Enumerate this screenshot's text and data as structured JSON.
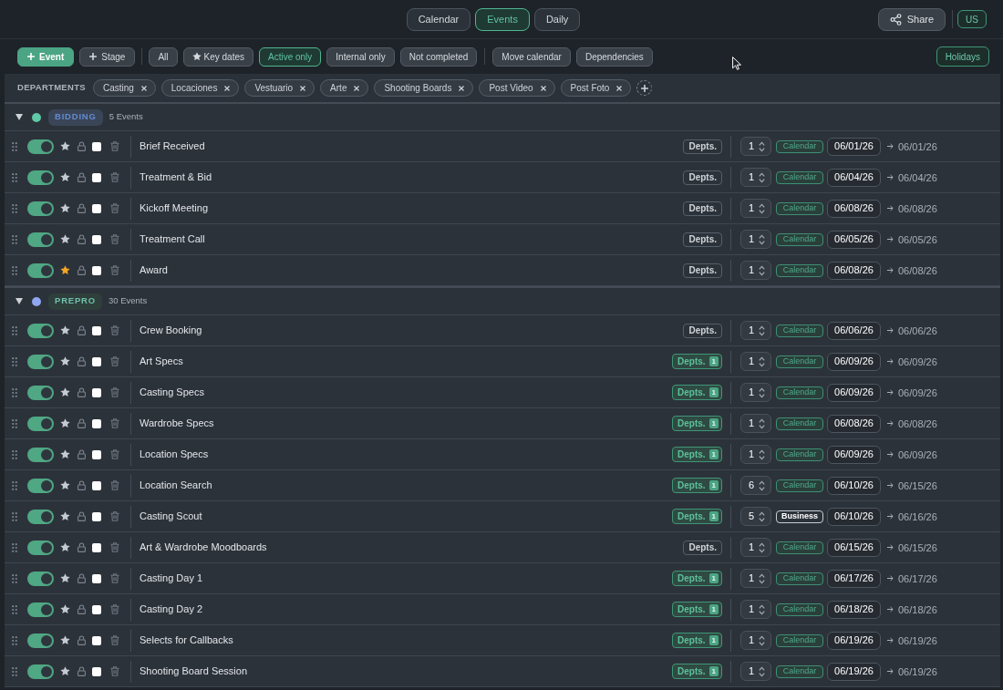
{
  "view_tabs": [
    {
      "label": "Calendar",
      "selected": false
    },
    {
      "label": "Events",
      "selected": true
    },
    {
      "label": "Daily",
      "selected": false
    }
  ],
  "share_button": "Share",
  "region_button": "US",
  "toolbar": {
    "create_buttons": [
      {
        "label": "Event",
        "kind": "primary"
      },
      {
        "label": "Stage",
        "kind": "secondary"
      }
    ],
    "filters": [
      {
        "label": "All",
        "kind": "plain",
        "selected": false
      },
      {
        "label": "Key dates",
        "kind": "key",
        "selected": false
      },
      {
        "label": "Active only",
        "kind": "plain",
        "selected": true
      },
      {
        "label": "Internal only",
        "kind": "plain",
        "selected": false
      },
      {
        "label": "Not completed",
        "kind": "plain",
        "selected": false
      }
    ],
    "actions": [
      "Move calendar",
      "Dependencies"
    ],
    "holidays": {
      "label": "Holidays",
      "on": true
    }
  },
  "departments": {
    "label": "DEPARTMENTS",
    "chips": [
      "Casting",
      "Locaciones",
      "Vestuario",
      "Arte",
      "Shooting Boards",
      "Post Video",
      "Post Foto"
    ]
  },
  "groups": [
    {
      "badge": {
        "label": "BIDDING",
        "color": "#3a4557"
      },
      "count": "5 Events",
      "expanded": true,
      "color": "#5fcaa5",
      "events": [
        {
          "name": "Brief Received",
          "enabled": true,
          "starred": false,
          "checked": false,
          "depts": {
            "label": "Depts."
          },
          "duration": "1",
          "day_type": {
            "kind": "calendar",
            "label": "Calendar"
          },
          "start": "06/01/26",
          "end": "06/01/26"
        },
        {
          "name": "Treatment & Bid",
          "enabled": true,
          "starred": false,
          "checked": false,
          "depts": {
            "label": "Depts."
          },
          "duration": "1",
          "day_type": {
            "kind": "calendar",
            "label": "Calendar"
          },
          "start": "06/04/26",
          "end": "06/04/26"
        },
        {
          "name": "Kickoff Meeting",
          "enabled": true,
          "starred": false,
          "checked": false,
          "depts": {
            "label": "Depts."
          },
          "duration": "1",
          "day_type": {
            "kind": "calendar",
            "label": "Calendar"
          },
          "start": "06/08/26",
          "end": "06/08/26"
        },
        {
          "name": "Treatment Call",
          "enabled": true,
          "starred": false,
          "checked": false,
          "depts": {
            "label": "Depts."
          },
          "duration": "1",
          "day_type": {
            "kind": "calendar",
            "label": "Calendar"
          },
          "start": "06/05/26",
          "end": "06/05/26"
        },
        {
          "name": "Award",
          "enabled": true,
          "starred": true,
          "checked": false,
          "depts": {
            "label": "Depts."
          },
          "duration": "1",
          "day_type": {
            "kind": "calendar",
            "label": "Calendar"
          },
          "start": "06/08/26",
          "end": "06/08/26"
        }
      ]
    },
    {
      "badge": {
        "label": "PREPRO",
        "color": "#2f3f3b"
      },
      "count": "30 Events",
      "expanded": true,
      "color": "#8fa7ef",
      "events": [
        {
          "name": "Crew Booking",
          "enabled": true,
          "starred": false,
          "checked": false,
          "depts": {
            "label": "Depts."
          },
          "duration": "1",
          "day_type": {
            "kind": "calendar",
            "label": "Calendar"
          },
          "start": "06/06/26",
          "end": "06/06/26"
        },
        {
          "name": "Art Specs",
          "enabled": true,
          "starred": false,
          "checked": false,
          "depts": {
            "label": "Depts.",
            "count": "1"
          },
          "duration": "1",
          "day_type": {
            "kind": "calendar",
            "label": "Calendar"
          },
          "start": "06/09/26",
          "end": "06/09/26"
        },
        {
          "name": "Casting Specs",
          "enabled": true,
          "starred": false,
          "checked": false,
          "depts": {
            "label": "Depts.",
            "count": "1"
          },
          "duration": "1",
          "day_type": {
            "kind": "calendar",
            "label": "Calendar"
          },
          "start": "06/09/26",
          "end": "06/09/26"
        },
        {
          "name": "Wardrobe Specs",
          "enabled": true,
          "starred": false,
          "checked": false,
          "depts": {
            "label": "Depts.",
            "count": "1"
          },
          "duration": "1",
          "day_type": {
            "kind": "calendar",
            "label": "Calendar"
          },
          "start": "06/08/26",
          "end": "06/08/26"
        },
        {
          "name": "Location Specs",
          "enabled": true,
          "starred": false,
          "checked": false,
          "depts": {
            "label": "Depts.",
            "count": "1"
          },
          "duration": "1",
          "day_type": {
            "kind": "calendar",
            "label": "Calendar"
          },
          "start": "06/09/26",
          "end": "06/09/26"
        },
        {
          "name": "Location Search",
          "enabled": true,
          "starred": false,
          "checked": false,
          "depts": {
            "label": "Depts.",
            "count": "1"
          },
          "duration": "6",
          "day_type": {
            "kind": "calendar",
            "label": "Calendar"
          },
          "start": "06/10/26",
          "end": "06/15/26"
        },
        {
          "name": "Casting Scout",
          "enabled": true,
          "starred": false,
          "checked": false,
          "depts": {
            "label": "Depts.",
            "count": "1"
          },
          "duration": "5",
          "day_type": {
            "kind": "business",
            "label": "Business"
          },
          "start": "06/10/26",
          "end": "06/16/26"
        },
        {
          "name": "Art & Wardrobe Moodboards",
          "enabled": true,
          "starred": false,
          "checked": false,
          "depts": {
            "label": "Depts."
          },
          "duration": "1",
          "day_type": {
            "kind": "calendar",
            "label": "Calendar"
          },
          "start": "06/15/26",
          "end": "06/15/26"
        },
        {
          "name": "Casting Day 1",
          "enabled": true,
          "starred": false,
          "checked": false,
          "depts": {
            "label": "Depts.",
            "count": "1"
          },
          "duration": "1",
          "day_type": {
            "kind": "calendar",
            "label": "Calendar"
          },
          "start": "06/17/26",
          "end": "06/17/26"
        },
        {
          "name": "Casting Day 2",
          "enabled": true,
          "starred": false,
          "checked": false,
          "depts": {
            "label": "Depts.",
            "count": "1"
          },
          "duration": "1",
          "day_type": {
            "kind": "calendar",
            "label": "Calendar"
          },
          "start": "06/18/26",
          "end": "06/18/26"
        },
        {
          "name": "Selects for Callbacks",
          "enabled": true,
          "starred": false,
          "checked": false,
          "depts": {
            "label": "Depts.",
            "count": "1"
          },
          "duration": "1",
          "day_type": {
            "kind": "calendar",
            "label": "Calendar"
          },
          "start": "06/19/26",
          "end": "06/19/26"
        },
        {
          "name": "Shooting Board Session",
          "enabled": true,
          "starred": false,
          "checked": false,
          "depts": {
            "label": "Depts.",
            "count": "1"
          },
          "duration": "1",
          "day_type": {
            "kind": "calendar",
            "label": "Calendar"
          },
          "start": "06/19/26",
          "end": "06/19/26"
        }
      ]
    }
  ]
}
